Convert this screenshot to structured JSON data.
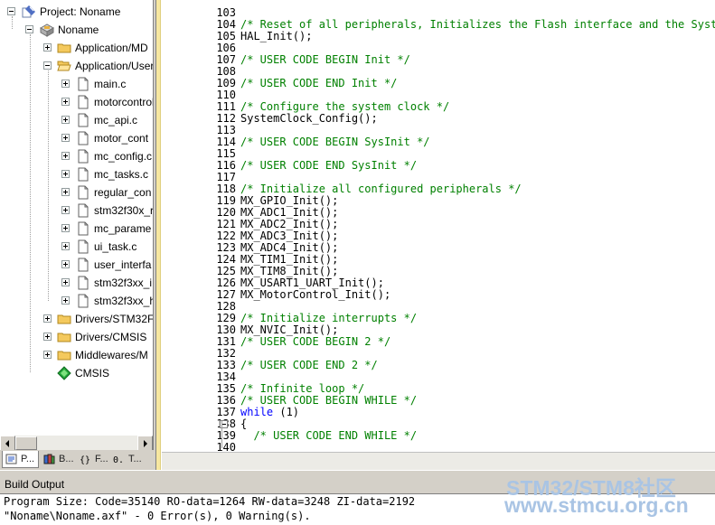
{
  "project_tree": {
    "root_label": "Project: Noname",
    "target_label": "Noname",
    "groups": [
      {
        "label": "Application/MD",
        "expanded": false
      },
      {
        "label": "Application/User",
        "expanded": true
      }
    ],
    "files": [
      "main.c",
      "motorcontrol",
      "mc_api.c",
      "motor_cont",
      "mc_config.c",
      "mc_tasks.c",
      "regular_con",
      "stm32f30x_r",
      "mc_parame",
      "ui_task.c",
      "user_interfa",
      "stm32f3xx_i",
      "stm32f3xx_h"
    ],
    "more_groups": [
      {
        "label": "Drivers/STM32F"
      },
      {
        "label": "Drivers/CMSIS"
      },
      {
        "label": "Middlewares/M"
      }
    ],
    "component_label": "CMSIS"
  },
  "panel_tabs": [
    {
      "label": "P...",
      "icon": "project-icon",
      "active": true
    },
    {
      "label": "B...",
      "icon": "books-icon",
      "active": false
    },
    {
      "label": "F...",
      "icon": "functions-icon",
      "active": false
    },
    {
      "label": "T...",
      "icon": "templates-icon",
      "active": false
    }
  ],
  "editor": {
    "lines": [
      {
        "num": "103",
        "text": "",
        "kind": "plain"
      },
      {
        "num": "104",
        "text": "/* Reset of all peripherals, Initializes the Flash interface and the Systick",
        "kind": "comment"
      },
      {
        "num": "105",
        "text": "HAL_Init();",
        "kind": "plain"
      },
      {
        "num": "106",
        "text": "",
        "kind": "plain"
      },
      {
        "num": "107",
        "text": "/* USER CODE BEGIN Init */",
        "kind": "comment"
      },
      {
        "num": "108",
        "text": "",
        "kind": "plain"
      },
      {
        "num": "109",
        "text": "/* USER CODE END Init */",
        "kind": "comment"
      },
      {
        "num": "110",
        "text": "",
        "kind": "plain"
      },
      {
        "num": "111",
        "text": "/* Configure the system clock */",
        "kind": "comment"
      },
      {
        "num": "112",
        "text": "SystemClock_Config();",
        "kind": "plain"
      },
      {
        "num": "113",
        "text": "",
        "kind": "plain"
      },
      {
        "num": "114",
        "text": "/* USER CODE BEGIN SysInit */",
        "kind": "comment"
      },
      {
        "num": "115",
        "text": "",
        "kind": "plain"
      },
      {
        "num": "116",
        "text": "/* USER CODE END SysInit */",
        "kind": "comment"
      },
      {
        "num": "117",
        "text": "",
        "kind": "plain"
      },
      {
        "num": "118",
        "text": "/* Initialize all configured peripherals */",
        "kind": "comment"
      },
      {
        "num": "119",
        "text": "MX_GPIO_Init();",
        "kind": "plain"
      },
      {
        "num": "120",
        "text": "MX_ADC1_Init();",
        "kind": "plain"
      },
      {
        "num": "121",
        "text": "MX_ADC2_Init();",
        "kind": "plain"
      },
      {
        "num": "122",
        "text": "MX_ADC3_Init();",
        "kind": "plain"
      },
      {
        "num": "123",
        "text": "MX_ADC4_Init();",
        "kind": "plain"
      },
      {
        "num": "124",
        "text": "MX_TIM1_Init();",
        "kind": "plain"
      },
      {
        "num": "125",
        "text": "MX_TIM8_Init();",
        "kind": "plain"
      },
      {
        "num": "126",
        "text": "MX_USART1_UART_Init();",
        "kind": "plain"
      },
      {
        "num": "127",
        "text": "MX_MotorControl_Init();",
        "kind": "plain"
      },
      {
        "num": "128",
        "text": "",
        "kind": "plain"
      },
      {
        "num": "129",
        "text": "/* Initialize interrupts */",
        "kind": "comment"
      },
      {
        "num": "130",
        "text": "MX_NVIC_Init();",
        "kind": "plain"
      },
      {
        "num": "131",
        "text": "/* USER CODE BEGIN 2 */",
        "kind": "comment"
      },
      {
        "num": "132",
        "text": "",
        "kind": "plain"
      },
      {
        "num": "133",
        "text": "/* USER CODE END 2 */",
        "kind": "comment"
      },
      {
        "num": "134",
        "text": "",
        "kind": "plain"
      },
      {
        "num": "135",
        "text": "/* Infinite loop */",
        "kind": "comment"
      },
      {
        "num": "136",
        "text": "/* USER CODE BEGIN WHILE */",
        "kind": "comment"
      },
      {
        "num": "137",
        "text": "while (1)",
        "kind": "keyword"
      },
      {
        "num": "138",
        "text": "{",
        "kind": "plain"
      },
      {
        "num": "139",
        "text": "  /* USER CODE END WHILE */",
        "kind": "comment"
      },
      {
        "num": "140",
        "text": "",
        "kind": "plain"
      }
    ]
  },
  "build_output": {
    "title": "Build Output",
    "lines": [
      "Program Size: Code=35140 RO-data=1264 RW-data=3248 ZI-data=2192",
      "\"Noname\\Noname.axf\" - 0 Error(s), 0 Warning(s)."
    ]
  },
  "watermark": {
    "line1": "STM32/STM8社区",
    "line2": "www.stmcu.org.cn"
  },
  "colors": {
    "comment": "#008000",
    "keyword": "#0000ff",
    "watermark": "#a9c4e4",
    "folder": "#f0c040"
  }
}
